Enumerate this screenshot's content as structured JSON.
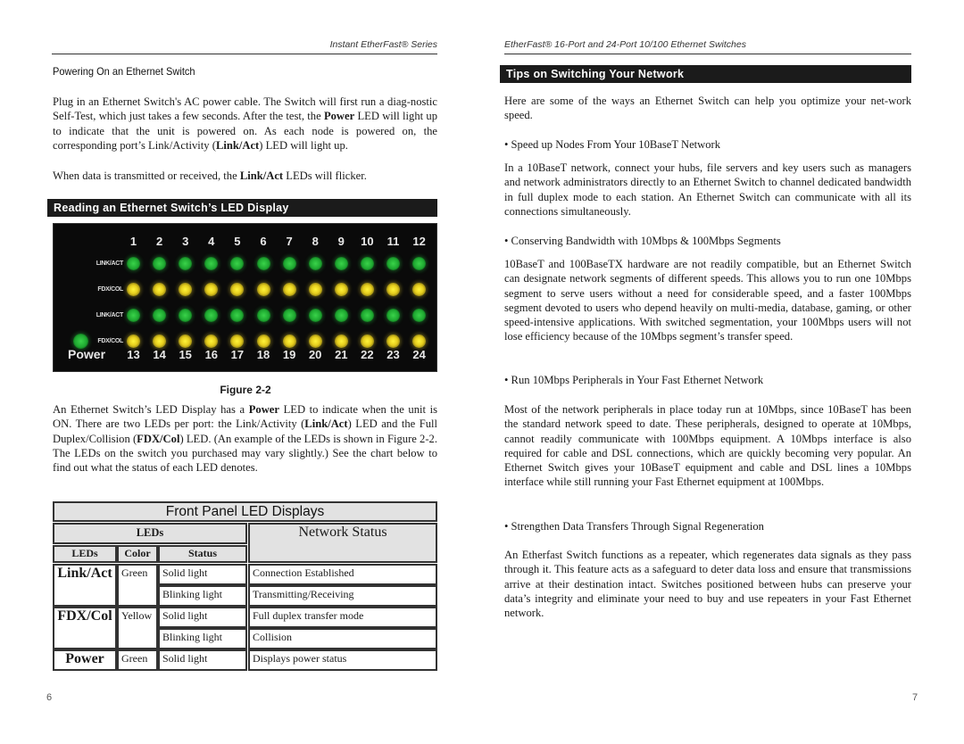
{
  "left_page": {
    "running_head": "Instant EtherFast® Series",
    "subheading": "Powering On an Ethernet Switch",
    "para1_html": "Plug in an Ethernet Switch's AC power cable. The Switch will first run a diag-nostic Self-Test, which just takes a few seconds.  After the test, the <b>Power</b> LED will light up to indicate that the unit is powered on.  As each node is powered on, the corresponding port’s Link/Activity (<b>Link/Act</b>) LED will light up.",
    "para2_html": "When data is transmitted or received, the <b>Link/Act</b> LEDs will flicker.",
    "section_title": "Reading an Ethernet Switch’s LED Display",
    "figure": {
      "top_ports": [
        "1",
        "2",
        "3",
        "4",
        "5",
        "6",
        "7",
        "8",
        "9",
        "10",
        "11",
        "12"
      ],
      "bottom_ports": [
        "13",
        "14",
        "15",
        "16",
        "17",
        "18",
        "19",
        "20",
        "21",
        "22",
        "23",
        "24"
      ],
      "row_labels": [
        "LINK/ACT",
        "FDX/COL",
        "LINK/ACT",
        "FDX/COL"
      ],
      "row_colors": [
        "green",
        "yellow",
        "green",
        "yellow"
      ],
      "power_label": "Power",
      "power_color": "green",
      "caption": "Figure 2-2"
    },
    "para3_html": "An Ethernet Switch’s LED Display has a <b>Power</b> LED to indicate when the unit is ON.  There are two LEDs per port: the Link/Activity (<b>Link/Act</b>) LED and the Full Duplex/Collision (<b>FDX/Col</b>) LED.  (An example of the LEDs is shown in Figure 2-2. The LEDs on the switch you purchased may vary slightly.) See the chart below to find out what the status of each LED denotes.",
    "table": {
      "title": "Front Panel LED Displays",
      "group_header": "LEDs",
      "network_status_header": "Network Status",
      "col_headers": [
        "LEDs",
        "Color",
        "Status"
      ],
      "groups": [
        {
          "led": "Link/Act",
          "color": "Green",
          "rows": [
            {
              "status": "Solid light",
              "network": "Connection Established"
            },
            {
              "status": "Blinking light",
              "network": "Transmitting/Receiving"
            }
          ]
        },
        {
          "led": "FDX/Col",
          "color": "Yellow",
          "rows": [
            {
              "status": "Solid light",
              "network": "Full duplex transfer mode"
            },
            {
              "status": "Blinking light",
              "network": "Collision"
            }
          ]
        },
        {
          "led": "Power",
          "color": "Green",
          "rows": [
            {
              "status": "Solid light",
              "network": "Displays power status"
            }
          ]
        }
      ]
    },
    "page_number": "6"
  },
  "right_page": {
    "running_head": "EtherFast® 16-Port and 24-Port 10/100 Ethernet Switches",
    "section_title": "Tips on Switching Your Network",
    "intro": "Here are some of the ways an Ethernet Switch can help you optimize your net-work speed.",
    "tips": [
      {
        "bullet": "• Speed up Nodes From Your 10BaseT Network",
        "body": "In a 10BaseT network, connect your hubs, file servers and key users such as managers and network administrators directly to an Ethernet Switch to channel dedicated bandwidth in full duplex mode to each station.  An Ethernet Switch can communicate with all its connections simultaneously."
      },
      {
        "bullet": "• Conserving Bandwidth with 10Mbps & 100Mbps Segments",
        "body": "10BaseT and 100BaseTX hardware are not readily compatible, but an Ethernet Switch can designate network segments of different speeds.  This allows you to run one 10Mbps segment to serve users without a need for considerable speed, and a faster 100Mbps segment devoted to users who depend heavily on multi-media, database, gaming, or other speed-intensive applications.  With switched segmentation, your 100Mbps users will not lose efficiency because of the 10Mbps segment’s transfer speed."
      },
      {
        "bullet": "• Run 10Mbps Peripherals in Your Fast Ethernet Network",
        "body": "Most of the network peripherals in place today run at 10Mbps, since 10BaseT has been the standard network speed to date. These peripherals, designed to operate at 10Mbps, cannot readily communicate with 100Mbps equipment.  A 10Mbps interface is also required for cable and DSL connections, which are quickly becoming very popular.  An Ethernet Switch gives your 10BaseT equipment and cable and DSL lines a 10Mbps interface while still running your Fast Ethernet equipment at 100Mbps."
      },
      {
        "bullet": "• Strengthen Data Transfers Through Signal Regeneration",
        "body": "An Etherfast Switch functions as a repeater, which regenerates data signals as they pass through it.  This feature acts as a safeguard to deter data loss and ensure that transmissions arrive at their destination intact.  Switches positioned between hubs can preserve your data’s integrity and eliminate your need to buy and use repeaters in your Fast Ethernet network."
      }
    ],
    "page_number": "7"
  }
}
